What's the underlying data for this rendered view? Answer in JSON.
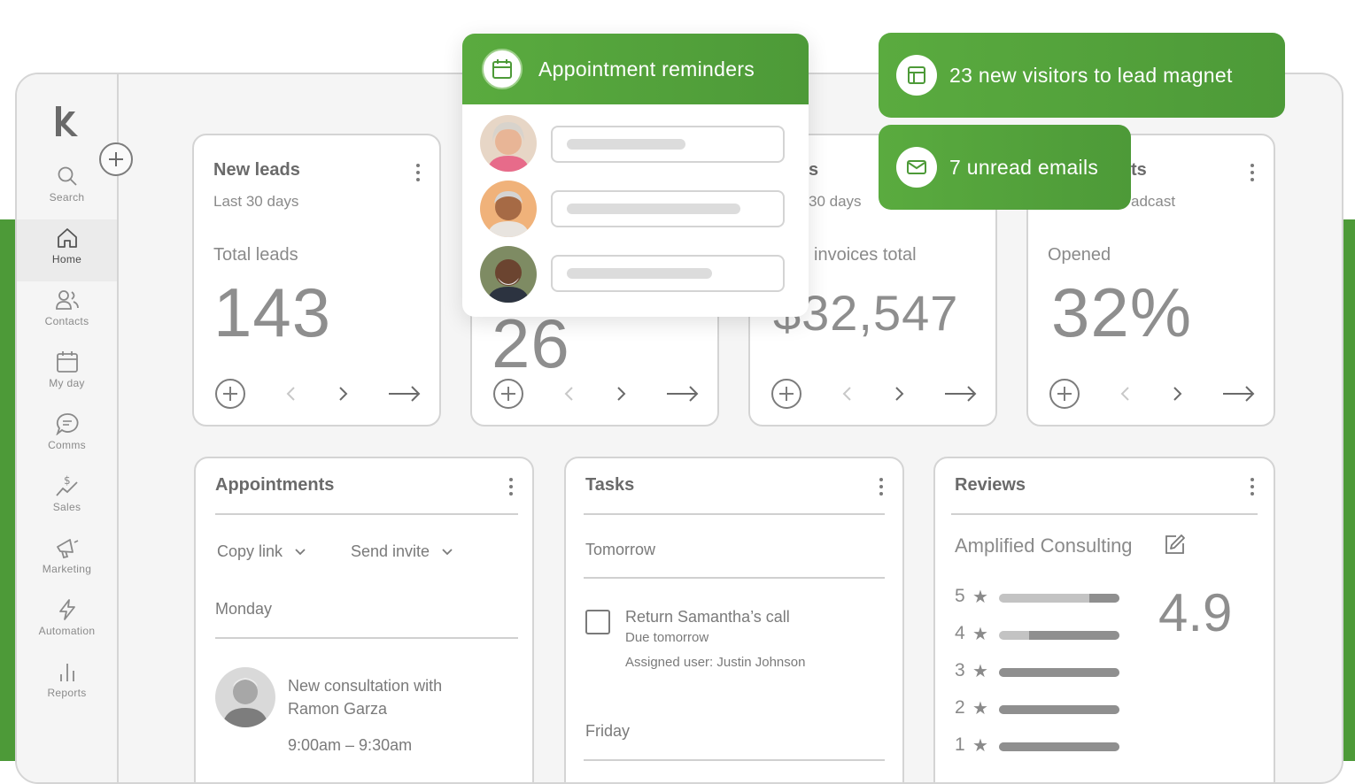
{
  "sidebar": {
    "items": [
      {
        "label": "Search",
        "icon": "search-icon"
      },
      {
        "label": "Home",
        "icon": "home-icon",
        "active": true
      },
      {
        "label": "Contacts",
        "icon": "contacts-icon"
      },
      {
        "label": "My day",
        "icon": "calendar-icon"
      },
      {
        "label": "Comms",
        "icon": "chat-icon"
      },
      {
        "label": "Sales",
        "icon": "sales-icon"
      },
      {
        "label": "Marketing",
        "icon": "megaphone-icon"
      },
      {
        "label": "Automation",
        "icon": "lightning-icon"
      },
      {
        "label": "Reports",
        "icon": "bar-chart-icon"
      }
    ]
  },
  "cards": {
    "leads": {
      "title": "New leads",
      "subtitle": "Last 30 days",
      "metric_label": "Total leads",
      "metric": "143"
    },
    "card2": {
      "metric_partial": "26"
    },
    "invoices": {
      "title_partial": "s",
      "subtitle_partial": "30 days",
      "metric_label_partial": "invoices total",
      "metric_partial": "$32,547"
    },
    "broadcast": {
      "title_partial": "ts",
      "subtitle_partial": "adcast",
      "metric_label": "Opened",
      "metric": "32%"
    }
  },
  "appointments": {
    "title": "Appointments",
    "copy_link": "Copy link",
    "send_invite": "Send invite",
    "day": "Monday",
    "item_title": "New consultation with Ramon Garza",
    "item_time": "9:00am – 9:30am"
  },
  "tasks": {
    "title": "Tasks",
    "group1": "Tomorrow",
    "task_title": "Return Samantha’s call",
    "task_due": "Due tomorrow",
    "task_assigned": "Assigned user: Justin Johnson",
    "group2": "Friday"
  },
  "reviews": {
    "title": "Reviews",
    "business": "Amplified Consulting",
    "rating": "4.9",
    "distribution": [
      {
        "stars": "5",
        "share": 0.25
      },
      {
        "stars": "4",
        "share": 0.75
      },
      {
        "stars": "3",
        "share": 1.0
      },
      {
        "stars": "2",
        "share": 1.0
      },
      {
        "stars": "1",
        "share": 1.0
      }
    ]
  },
  "popup": {
    "title": "Appointment reminders"
  },
  "notifications": {
    "visitors": "23 new visitors to lead magnet",
    "emails": "7 unread emails"
  },
  "colors": {
    "brand_green": "#4d9a38",
    "brand_green_light": "#5aab3f"
  }
}
